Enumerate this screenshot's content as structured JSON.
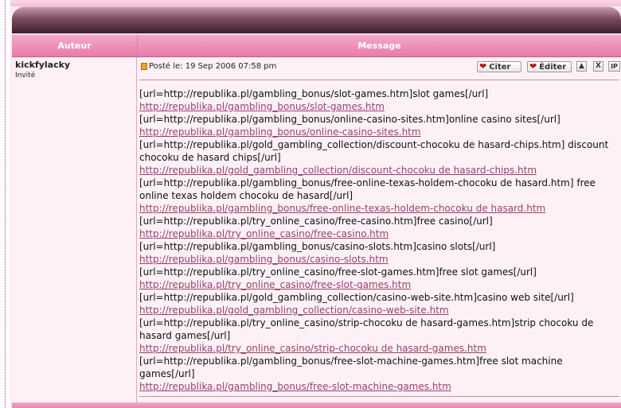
{
  "table": {
    "header_author": "Auteur",
    "header_message": "Message"
  },
  "post": {
    "author": "kickfylacky",
    "role": "Invité",
    "posted": "Posté le: 19 Sep 2006 07:58 pm",
    "buttons": {
      "cite": "Citer",
      "edit": "Éditer",
      "up": "▲",
      "delete": "X",
      "ip": "IP"
    },
    "lines": [
      {
        "type": "text",
        "v": "[url=http://republika.pl/gambling_bonus/slot-games.htm]slot games[/url]"
      },
      {
        "type": "link",
        "v": "http://republika.pl/gambling_bonus/slot-games.htm"
      },
      {
        "type": "text",
        "v": "[url=http://republika.pl/gambling_bonus/online-casino-sites.htm]online casino sites[/url]"
      },
      {
        "type": "link",
        "v": "http://republika.pl/gambling_bonus/online-casino-sites.htm"
      },
      {
        "type": "text",
        "v": "[url=http://republika.pl/gold_gambling_collection/discount-chocoku de hasard-chips.htm] discount chocoku de hasard chips[/url]"
      },
      {
        "type": "link",
        "v": "http://republika.pl/gold_gambling_collection/discount-chocoku de hasard-chips.htm"
      },
      {
        "type": "text",
        "v": "[url=http://republika.pl/gambling_bonus/free-online-texas-holdem-chocoku de hasard.htm] free online texas holdem chocoku de hasard[/url]"
      },
      {
        "type": "link",
        "v": "http://republika.pl/gambling_bonus/free-online-texas-holdem-chocoku de hasard.htm"
      },
      {
        "type": "text",
        "v": "[url=http://republika.pl/try_online_casino/free-casino.htm]free casino[/url]"
      },
      {
        "type": "link",
        "v": "http://republika.pl/try_online_casino/free-casino.htm"
      },
      {
        "type": "text",
        "v": "[url=http://republika.pl/gambling_bonus/casino-slots.htm]casino slots[/url]"
      },
      {
        "type": "link",
        "v": "http://republika.pl/gambling_bonus/casino-slots.htm"
      },
      {
        "type": "text",
        "v": "[url=http://republika.pl/try_online_casino/free-slot-games.htm]free slot games[/url]"
      },
      {
        "type": "link",
        "v": "http://republika.pl/try_online_casino/free-slot-games.htm"
      },
      {
        "type": "text",
        "v": "[url=http://republika.pl/gold_gambling_collection/casino-web-site.htm]casino web site[/url]"
      },
      {
        "type": "link",
        "v": "http://republika.pl/gold_gambling_collection/casino-web-site.htm"
      },
      {
        "type": "text",
        "v": "[url=http://republika.pl/try_online_casino/strip-chocoku de hasard-games.htm]strip chocoku de hasard games[/url]"
      },
      {
        "type": "link",
        "v": "http://republika.pl/try_online_casino/strip-chocoku de hasard-games.htm"
      },
      {
        "type": "text",
        "v": "[url=http://republika.pl/gambling_bonus/free-slot-machine-games.htm]free slot machine games[/url]"
      },
      {
        "type": "link",
        "v": "http://republika.pl/gambling_bonus/free-slot-machine-games.htm"
      }
    ]
  }
}
